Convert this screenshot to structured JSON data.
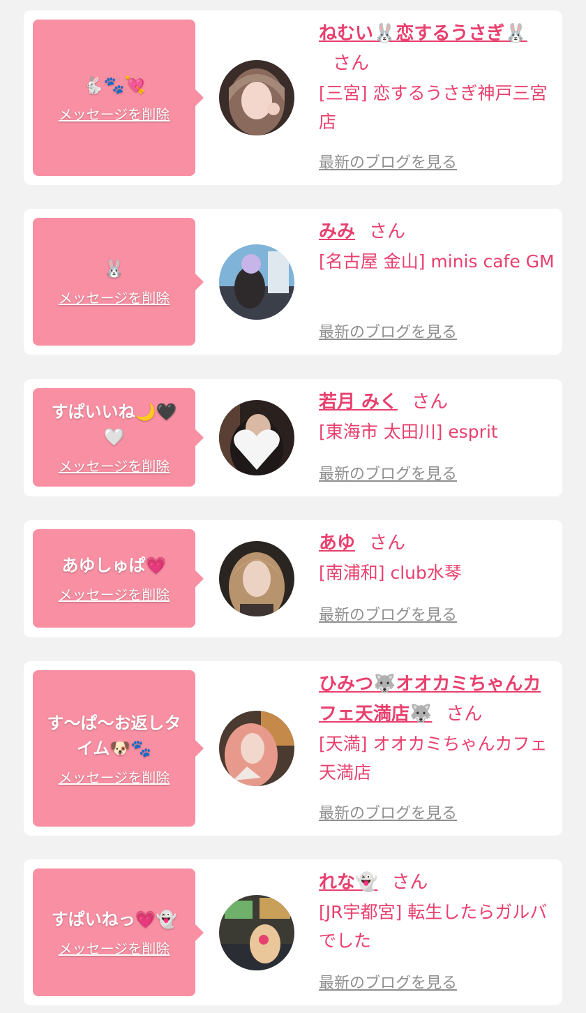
{
  "delete_label": "メッセージを削除",
  "san_label": "さん",
  "blog_label": "最新のブログを見る",
  "colors": {
    "background": "#f2f2f2",
    "bubble": "#f98fa3",
    "name_pink": "#e8406e",
    "blog_gray": "#8f8f8f"
  },
  "items": [
    {
      "message": "🐇🐾💘",
      "name": "ねむい🐰恋するうさぎ🐰",
      "shop": "[三宮] 恋するうさぎ神戸三宮店"
    },
    {
      "message": "🐰",
      "name": "みみ",
      "shop": "[名古屋 金山] minis cafe GM"
    },
    {
      "message": "すぱいいね🌙🖤🤍",
      "name": "若月 みく",
      "shop": "[東海市 太田川] esprit"
    },
    {
      "message": "あゆしゅぱ💗",
      "name": "あゆ",
      "shop": "[南浦和] club水琴"
    },
    {
      "message": "す〜ぱ〜お返しタイム🐶🐾",
      "name": "ひみつ🐺オオカミちゃんカフェ天満店🐺",
      "shop": "[天満] オオカミちゃんカフェ天満店"
    },
    {
      "message": "すぱいねっ💗👻",
      "name": "れな👻",
      "shop": "[JR宇都宮] 転生したらガルバでした"
    }
  ]
}
